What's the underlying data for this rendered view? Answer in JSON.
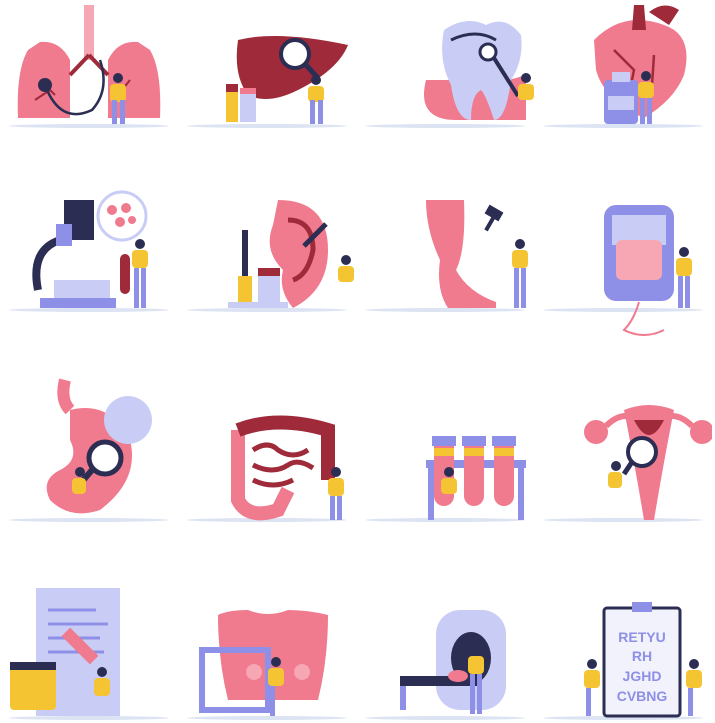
{
  "palette": {
    "pink": "#F07A8E",
    "light_pink": "#F6A7B3",
    "dark_red": "#9E2A3A",
    "lavender": "#8E8FE6",
    "light_lavender": "#C9CDF5",
    "yellow": "#F4C432",
    "navy": "#2B2D52",
    "skin": "#C98B6B",
    "ground": "#DCE3F3"
  },
  "eye_chart": {
    "lines": [
      "RETYU",
      "RH",
      "JGHD",
      "CVBNG"
    ]
  },
  "icons": [
    {
      "id": "lungs",
      "icon": "lungs-icon"
    },
    {
      "id": "liver",
      "icon": "liver-icon"
    },
    {
      "id": "tooth",
      "icon": "tooth-icon"
    },
    {
      "id": "heart",
      "icon": "heart-icon"
    },
    {
      "id": "microscope",
      "icon": "microscope-icon"
    },
    {
      "id": "ear",
      "icon": "ear-icon"
    },
    {
      "id": "leg",
      "icon": "leg-icon"
    },
    {
      "id": "blood-bag",
      "icon": "blood-bag-icon"
    },
    {
      "id": "stomach",
      "icon": "stomach-icon"
    },
    {
      "id": "intestine",
      "icon": "intestine-icon"
    },
    {
      "id": "test-tubes",
      "icon": "test-tubes-icon"
    },
    {
      "id": "uterus",
      "icon": "uterus-icon"
    },
    {
      "id": "lab-report",
      "icon": "lab-report-icon"
    },
    {
      "id": "breast-exam",
      "icon": "breast-exam-icon"
    },
    {
      "id": "mri-scanner",
      "icon": "mri-scanner-icon"
    },
    {
      "id": "eye-chart",
      "icon": "eye-chart-icon"
    }
  ]
}
